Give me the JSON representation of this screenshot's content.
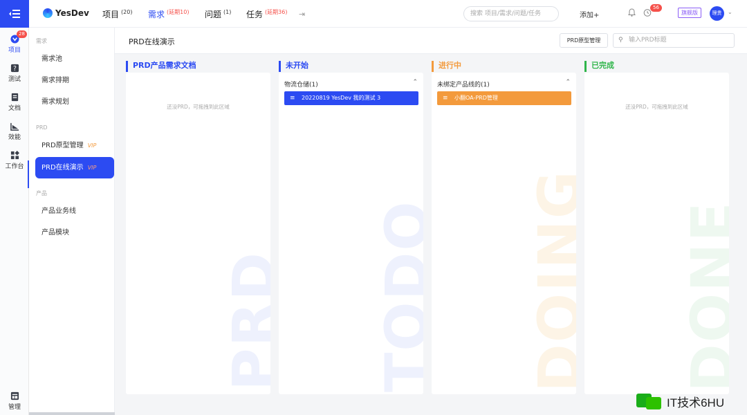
{
  "rail": {
    "items": [
      {
        "label": "项目",
        "icon": "project-icon",
        "badge": "28",
        "active": true
      },
      {
        "label": "测试",
        "icon": "test-icon"
      },
      {
        "label": "文档",
        "icon": "doc-icon"
      },
      {
        "label": "效能",
        "icon": "performance-icon"
      },
      {
        "label": "工作台",
        "icon": "workbench-icon"
      },
      {
        "label": "管理",
        "icon": "admin-icon"
      }
    ]
  },
  "header": {
    "brand": "YesDev",
    "nav": [
      {
        "label": "项目",
        "count": "(20)"
      },
      {
        "label": "需求",
        "count": "(延期10)"
      },
      {
        "label": "问题",
        "count": "(1)"
      },
      {
        "label": "任务",
        "count": "(延期36)"
      }
    ],
    "search_placeholder": "搜索 项目/需求/问题/任务",
    "add_label": "添加+",
    "clock_badge": "56",
    "edition": "旗舰版",
    "avatar": "理贵"
  },
  "sidebar": {
    "sections": [
      {
        "title": "需求",
        "items": [
          {
            "label": "需求池"
          },
          {
            "label": "需求排期"
          },
          {
            "label": "需求规划"
          }
        ]
      },
      {
        "title": "PRD",
        "items": [
          {
            "label": "PRD原型管理",
            "vip": "VIP"
          },
          {
            "label": "PRD在线演示",
            "vip": "VIP",
            "active": true
          }
        ]
      },
      {
        "title": "产品",
        "items": [
          {
            "label": "产品业务线"
          },
          {
            "label": "产品模块"
          }
        ]
      }
    ]
  },
  "main": {
    "title": "PRD在线演示",
    "proto_button": "PRD原型管理",
    "search_placeholder": "输入PRD标题",
    "columns": [
      {
        "title": "PRD产品需求文档",
        "color": "#2c4bf2",
        "empty": "还没PRD，可拖拽到此区域",
        "watermark": "PRD"
      },
      {
        "title": "未开始",
        "color": "#2c4bf2",
        "group": "物流仓储(1)",
        "card": "20220819 YesDev 我的测试 3",
        "card_color": "#2c4bf2",
        "watermark": "TODO"
      },
      {
        "title": "进行中",
        "color": "#f39a3c",
        "group": "未绑定产品线的(1)",
        "card": "小翻OA-PRD管理",
        "card_color": "#f39a3c",
        "watermark": "DOING"
      },
      {
        "title": "已完成",
        "color": "#2fb54a",
        "empty": "还没PRD，可拖拽到此区域",
        "watermark": "DONE"
      }
    ]
  },
  "footer": {
    "brand": "IT技术6HU"
  }
}
